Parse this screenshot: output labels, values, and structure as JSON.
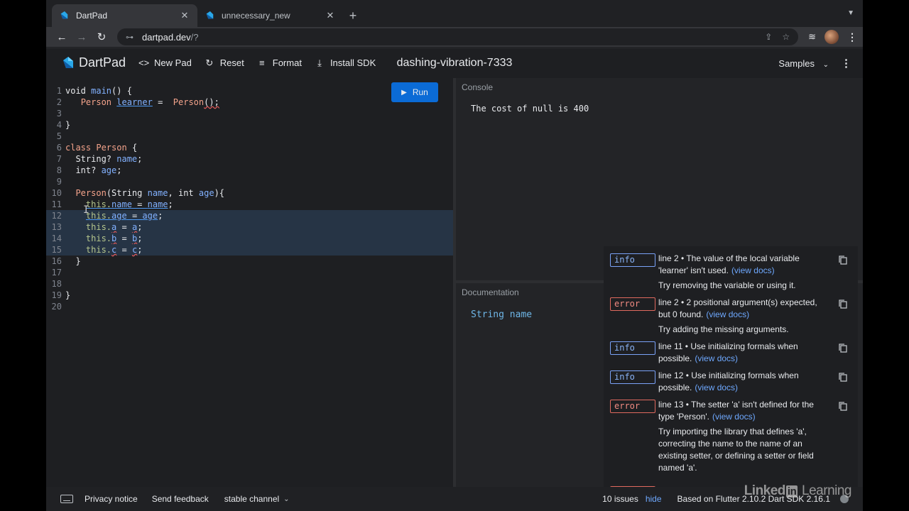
{
  "browser": {
    "tabs": [
      {
        "title": "DartPad",
        "active": true
      },
      {
        "title": "unnecessary_new",
        "active": false
      }
    ],
    "url": {
      "host": "dartpad.dev",
      "path": "/?"
    }
  },
  "header": {
    "brand": "DartPad",
    "buttons": {
      "new_pad": "New Pad",
      "reset": "Reset",
      "format": "Format",
      "install_sdk": "Install SDK"
    },
    "pad_name": "dashing-vibration-7333",
    "samples": "Samples"
  },
  "editor": {
    "run_label": "Run",
    "line_numbers": [
      "1",
      "2",
      "3",
      "4",
      "5",
      "6",
      "7",
      "8",
      "9",
      "10",
      "11",
      "12",
      "13",
      "14",
      "15",
      "16",
      "17",
      "18",
      "19",
      "20"
    ],
    "code": {
      "l1_kw": "void ",
      "l1_fn": "main",
      "l1_rest": "() {",
      "l2_type": "Person",
      "l2_var": "learner",
      "l2_eq": " =  ",
      "l2_ctor": "Person",
      "l2_call": "();",
      "l4": "}",
      "l6_kw": "class ",
      "l6_cls": "Person",
      "l6_rest": " {",
      "l7_type": "String? ",
      "l7_var": "name",
      "l7_semi": ";",
      "l8_type": "int? ",
      "l8_var": "age",
      "l8_semi": ";",
      "l10_ctor": "Person",
      "l10_a": "(String ",
      "l10_p1": "name",
      "l10_b": ", int ",
      "l10_p2": "age",
      "l10_c": "){",
      "l11_this": "this.",
      "l11_f": "name",
      "l11_eq": " = ",
      "l11_v": "name",
      "l11_semi": ";",
      "l12_this": "this.",
      "l12_f": "age",
      "l12_eq": " = ",
      "l12_v": "age",
      "l12_semi": ";",
      "l13_this": "this.",
      "l13_f": "a",
      "l13_eq": " = ",
      "l13_v": "a",
      "l13_semi": ";",
      "l14_this": "this.",
      "l14_f": "b",
      "l14_eq": " = ",
      "l14_v": "b",
      "l14_semi": ";",
      "l15_this": "this.",
      "l15_f": "c",
      "l15_eq": " = ",
      "l15_v": "c",
      "l15_semi": ";",
      "l16": "}",
      "l19": "}"
    }
  },
  "console": {
    "label": "Console",
    "output": "The cost of null is 400"
  },
  "documentation": {
    "label": "Documentation",
    "content": "String name"
  },
  "issues": [
    {
      "kind": "info",
      "message": "line 2 • The value of the local variable 'learner' isn't used.",
      "link": "(view docs)",
      "fix": "Try removing the variable or using it."
    },
    {
      "kind": "error",
      "message": "line 2 • 2 positional argument(s) expected, but 0 found.",
      "link": "(view docs)",
      "fix": "Try adding the missing arguments."
    },
    {
      "kind": "info",
      "message": "line 11 • Use initializing formals when possible.",
      "link": "(view docs)",
      "fix": ""
    },
    {
      "kind": "info",
      "message": "line 12 • Use initializing formals when possible.",
      "link": "(view docs)",
      "fix": ""
    },
    {
      "kind": "error",
      "message": "line 13 • The setter 'a' isn't defined for the type 'Person'.",
      "link": "(view docs)",
      "fix": "Try importing the library that defines 'a', correcting the name to the name of an existing setter, or defining a setter or field named 'a'."
    }
  ],
  "footer": {
    "privacy": "Privacy notice",
    "feedback": "Send feedback",
    "channel": "stable channel",
    "issue_count": "10 issues",
    "hide": "hide",
    "version": "Based on Flutter 2.10.2 Dart SDK 2.16.1"
  },
  "watermark": {
    "linked": "Linked",
    "in": "in",
    "learning": " Learning"
  },
  "colors": {
    "run_button": "#0b6bd6",
    "info_badge": "#8ab4f8",
    "error_badge": "#f28b82",
    "link": "#6ea8fe"
  }
}
